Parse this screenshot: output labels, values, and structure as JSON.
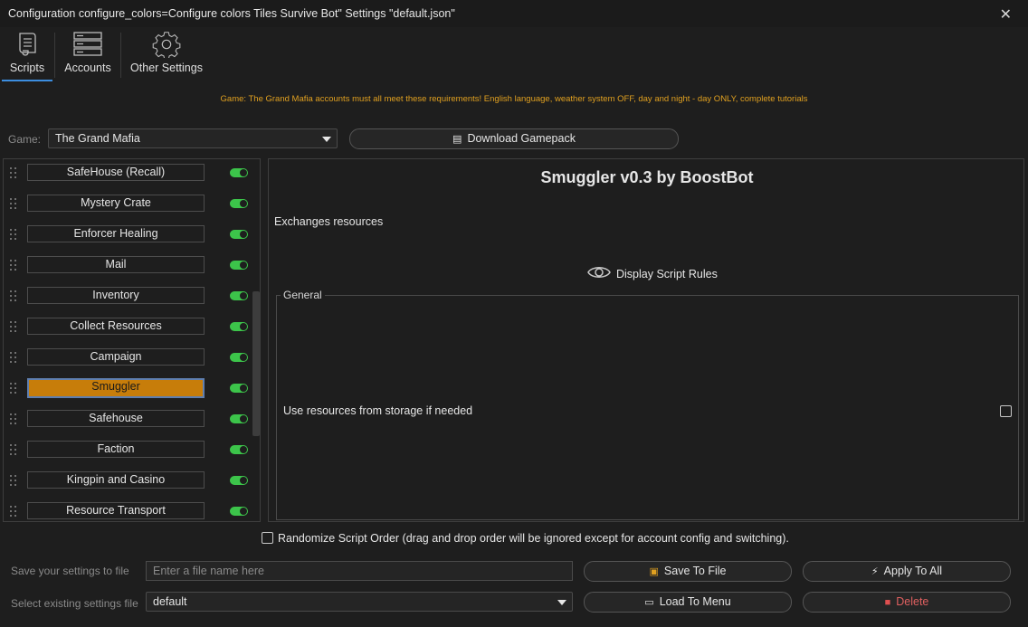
{
  "window": {
    "title": "Configuration configure_colors=Configure colors Tiles Survive Bot\" Settings \"default.json\"",
    "close_glyph": "✕"
  },
  "tabs": [
    {
      "label": "Scripts",
      "icon": "scroll-icon",
      "active": true
    },
    {
      "label": "Accounts",
      "icon": "server-icon",
      "active": false
    },
    {
      "label": "Other Settings",
      "icon": "gear-icon",
      "active": false
    }
  ],
  "notice": "Game: The Grand Mafia accounts must all meet these requirements! English language, weather system OFF, day and night - day ONLY, complete tutorials",
  "game": {
    "label": "Game:",
    "selected": "The Grand Mafia",
    "download_label": "Download Gamepack",
    "download_icon": "package-icon"
  },
  "scripts": [
    {
      "label": "SafeHouse (Recall)",
      "enabled": true,
      "selected": false
    },
    {
      "label": "Mystery Crate",
      "enabled": true,
      "selected": false
    },
    {
      "label": "Enforcer Healing",
      "enabled": true,
      "selected": false
    },
    {
      "label": "Mail",
      "enabled": true,
      "selected": false
    },
    {
      "label": "Inventory",
      "enabled": true,
      "selected": false
    },
    {
      "label": "Collect Resources",
      "enabled": true,
      "selected": false
    },
    {
      "label": "Campaign",
      "enabled": true,
      "selected": false
    },
    {
      "label": "Smuggler",
      "enabled": true,
      "selected": true
    },
    {
      "label": "Safehouse",
      "enabled": true,
      "selected": false
    },
    {
      "label": "Faction",
      "enabled": true,
      "selected": false
    },
    {
      "label": "Kingpin and Casino",
      "enabled": true,
      "selected": false
    },
    {
      "label": "Resource Transport",
      "enabled": true,
      "selected": false
    }
  ],
  "script_detail": {
    "title": "Smuggler v0.3 by BoostBot",
    "description": "Exchanges resources",
    "rules_label": "Display Script Rules",
    "rules_icon": "eye-icon",
    "group_label": "General",
    "option_label": "Use resources from storage if needed",
    "option_checked": false
  },
  "randomize": {
    "label": "Randomize Script Order (drag and drop order will be ignored except for account config and switching).",
    "checked": false
  },
  "settings_file": {
    "save_label": "Save your settings to file",
    "save_placeholder": "Enter a file name here",
    "save_button": "Save To File",
    "save_icon": "floppy-icon",
    "apply_button": "Apply To All",
    "apply_icon": "lightning-icon",
    "select_label": "Select existing settings file",
    "selected_file": "default",
    "load_button": "Load To Menu",
    "load_icon": "tray-icon",
    "delete_button": "Delete",
    "delete_icon": "trash-icon",
    "accent_color": "#3c8ee0",
    "selected_color": "#c77d0a",
    "toggle_color": "#3cc44a",
    "notice_color": "#e0a020"
  }
}
